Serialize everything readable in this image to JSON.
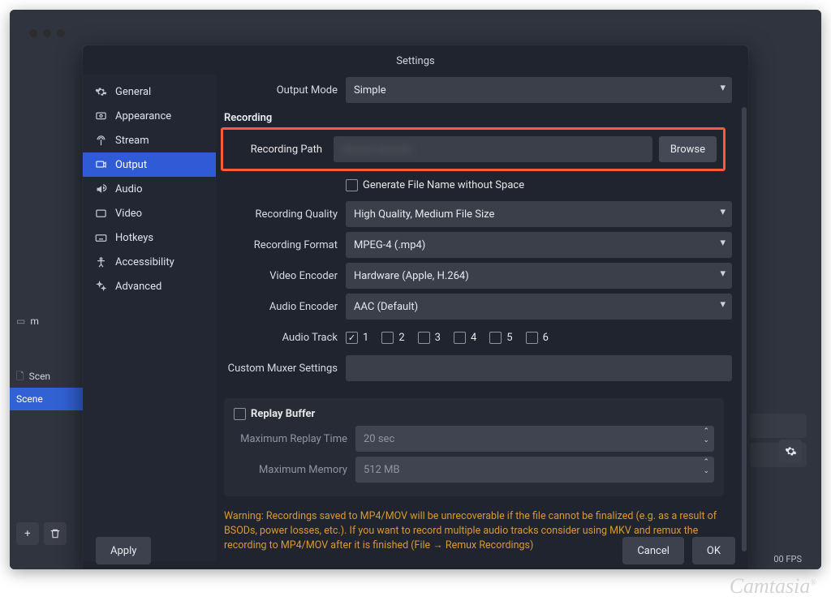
{
  "window": {
    "title": "Settings"
  },
  "sidebar": {
    "items": [
      {
        "label": "General",
        "icon": "gear-icon"
      },
      {
        "label": "Appearance",
        "icon": "appearance-icon"
      },
      {
        "label": "Stream",
        "icon": "antenna-icon"
      },
      {
        "label": "Output",
        "icon": "output-icon",
        "active": true
      },
      {
        "label": "Audio",
        "icon": "audio-icon"
      },
      {
        "label": "Video",
        "icon": "video-icon"
      },
      {
        "label": "Hotkeys",
        "icon": "keyboard-icon"
      },
      {
        "label": "Accessibility",
        "icon": "accessibility-icon"
      },
      {
        "label": "Advanced",
        "icon": "advanced-icon"
      }
    ]
  },
  "output": {
    "output_mode_label": "Output Mode",
    "output_mode_value": "Simple",
    "section_recording": "Recording",
    "recording_path_label": "Recording Path",
    "recording_path_value": "",
    "browse_label": "Browse",
    "generate_filename_label": "Generate File Name without Space",
    "recording_quality_label": "Recording Quality",
    "recording_quality_value": "High Quality, Medium File Size",
    "recording_format_label": "Recording Format",
    "recording_format_value": "MPEG-4 (.mp4)",
    "video_encoder_label": "Video Encoder",
    "video_encoder_value": "Hardware (Apple, H.264)",
    "audio_encoder_label": "Audio Encoder",
    "audio_encoder_value": "AAC (Default)",
    "audio_track_label": "Audio Track",
    "audio_tracks": [
      "1",
      "2",
      "3",
      "4",
      "5",
      "6"
    ],
    "audio_track_checked": 0,
    "custom_muxer_label": "Custom Muxer Settings",
    "custom_muxer_value": ""
  },
  "replay": {
    "title": "Replay Buffer",
    "max_time_label": "Maximum Replay Time",
    "max_time_value": "20 sec",
    "max_mem_label": "Maximum Memory",
    "max_mem_value": "512 MB"
  },
  "warning": "Warning: Recordings saved to MP4/MOV will be unrecoverable if the file cannot be finalized (e.g. as a result of BSODs, power losses, etc.). If you want to record multiple audio tracks consider using MKV and remux the recording to MP4/MOV after it is finished (File → Remux Recordings)",
  "footer": {
    "apply": "Apply",
    "cancel": "Cancel",
    "ok": "OK"
  },
  "background": {
    "row1": "m",
    "row2": "Scen",
    "row3": "Scene",
    "fps": "00 FPS"
  },
  "watermark": "Camtasia"
}
